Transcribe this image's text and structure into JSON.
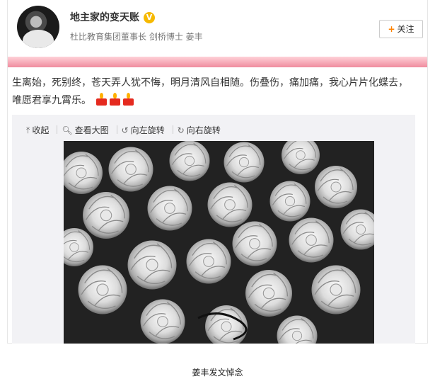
{
  "post": {
    "username": "地主家的变天账",
    "verified_badge": "V",
    "bio": "杜比教育集团董事长 剑桥博士 姜丰",
    "follow_label": "关注",
    "text": "生离始，死别终，苍天弄人犹不悔，明月清风自相随。伤叠伤，痛加痛，我心片片化蝶去，唯愿君享九霄乐。",
    "emojis": [
      "candle-icon",
      "candle-icon",
      "candle-icon"
    ]
  },
  "media": {
    "toolbar": [
      {
        "icon": "arrow-up-icon",
        "glyph": "⤒",
        "label": "收起"
      },
      {
        "icon": "magnify-icon",
        "glyph": "🔍︎",
        "label": "查看大图"
      },
      {
        "icon": "rotate-left-icon",
        "glyph": "↺",
        "label": "向左旋转"
      },
      {
        "icon": "rotate-right-icon",
        "glyph": "↻",
        "label": "向右旋转"
      }
    ]
  },
  "caption": "姜丰发文悼念",
  "colors": {
    "accent": "#ff8200",
    "verified": "#f6b900",
    "band_top": "#ffd1d8",
    "band_bottom": "#f08c9e"
  }
}
